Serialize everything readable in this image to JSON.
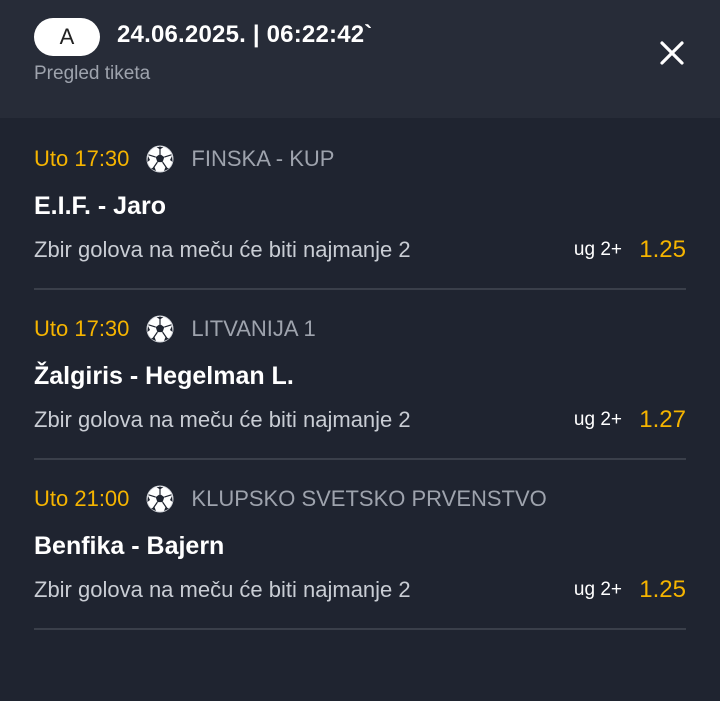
{
  "header": {
    "ticket_type": "A",
    "datetime": "24.06.2025. | 06:22:42`",
    "subtitle": "Pregled tiketa"
  },
  "icons": {
    "close": "close-icon",
    "sport": "soccer-ball-icon"
  },
  "colors": {
    "accent": "#f5b400",
    "background": "#1f2430",
    "header_background": "#272c38",
    "muted_text": "#9ea3ad",
    "divider": "#3a3f4a"
  },
  "matches": [
    {
      "time": "Uto 17:30",
      "league": "FINSKA - KUP",
      "teams": "E.I.F. - Jaro",
      "bet": "Zbir golova na meču će biti najmanje 2",
      "code": "ug 2+",
      "odds": "1.25"
    },
    {
      "time": "Uto 17:30",
      "league": "LITVANIJA 1",
      "teams": "Žalgiris - Hegelman L.",
      "bet": "Zbir golova na meču će biti najmanje 2",
      "code": "ug 2+",
      "odds": "1.27"
    },
    {
      "time": "Uto 21:00",
      "league": "KLUPSKO SVETSKO PRVENSTVO",
      "teams": "Benfika - Bajern",
      "bet": "Zbir golova na meču će biti najmanje 2",
      "code": "ug 2+",
      "odds": "1.25"
    }
  ]
}
